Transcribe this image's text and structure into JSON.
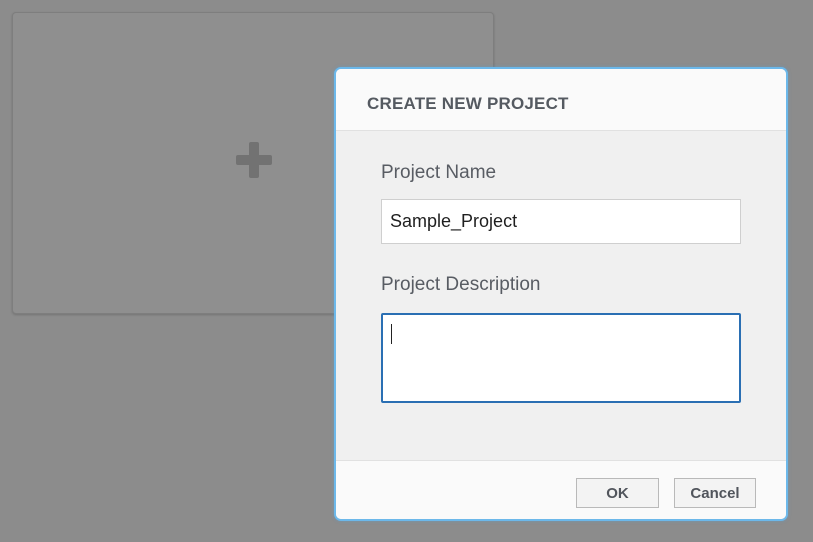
{
  "background_card": {
    "icon": "plus-icon"
  },
  "dialog": {
    "title": "CREATE NEW PROJECT",
    "accent_color": "#6cb8ea",
    "fields": {
      "project_name": {
        "label": "Project Name",
        "value": "Sample_Project"
      },
      "project_description": {
        "label": "Project Description",
        "value": ""
      }
    },
    "buttons": {
      "ok_label": "OK",
      "cancel_label": "Cancel"
    }
  }
}
